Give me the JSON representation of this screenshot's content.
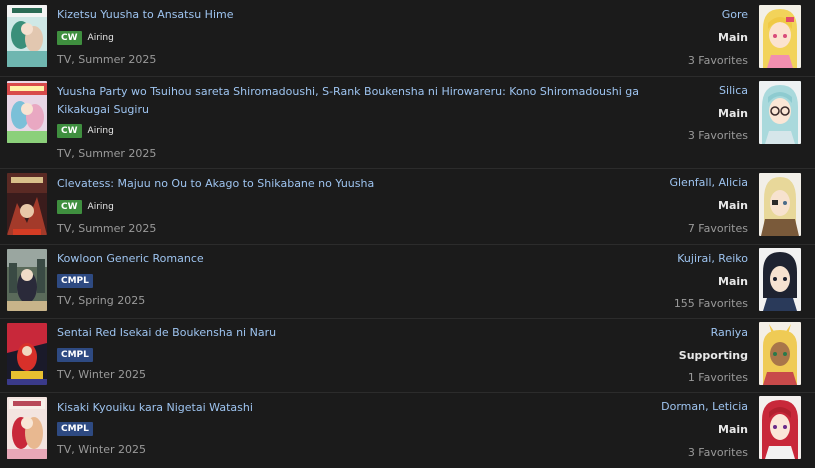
{
  "colors": {
    "background": "#1b1b1b",
    "link": "#9ec4f0",
    "cw_badge": "#3f8f3f",
    "cmpl_badge": "#2e4a82"
  },
  "entries": [
    {
      "title": "Kizetsu Yuusha to Ansatsu Hime",
      "badge": "CW",
      "badge_color": "#3f8f3f",
      "status": "Airing",
      "meta": "TV, Summer 2025",
      "character": "Gore",
      "role": "Main",
      "favorites": "3 Favorites",
      "cover_icon": "anime-cover-image",
      "portrait_icon": "blonde-girl-portrait"
    },
    {
      "title": "Yuusha Party wo Tsuihou sareta Shiromadoushi, S-Rank Boukensha ni Hirowareru: Kono Shiromadoushi ga Kikakugai Sugiru",
      "badge": "CW",
      "badge_color": "#3f8f3f",
      "status": "Airing",
      "meta": "TV, Summer 2025",
      "character": "Silica",
      "role": "Main",
      "favorites": "3 Favorites",
      "cover_icon": "anime-cover-image",
      "portrait_icon": "teal-hair-glasses-girl-portrait"
    },
    {
      "title": "Clevatess: Majuu no Ou to Akago to Shikabane no Yuusha",
      "badge": "CW",
      "badge_color": "#3f8f3f",
      "status": "Airing",
      "meta": "TV, Summer 2025",
      "character": "Glenfall, Alicia",
      "role": "Main",
      "favorites": "7 Favorites",
      "cover_icon": "anime-cover-image",
      "portrait_icon": "blonde-eyepatch-girl-portrait"
    },
    {
      "title": "Kowloon Generic Romance",
      "badge": "CMPL",
      "badge_color": "#2e4a82",
      "status": "",
      "meta": "TV, Spring 2025",
      "character": "Kujirai, Reiko",
      "role": "Main",
      "favorites": "155 Favorites",
      "cover_icon": "anime-cover-image",
      "portrait_icon": "dark-hair-girl-portrait"
    },
    {
      "title": "Sentai Red Isekai de Boukensha ni Naru",
      "badge": "CMPL",
      "badge_color": "#2e4a82",
      "status": "",
      "meta": "TV, Winter 2025",
      "character": "Raniya",
      "role": "Supporting",
      "favorites": "1 Favorites",
      "cover_icon": "anime-cover-image",
      "portrait_icon": "blonde-bunny-girl-portrait"
    },
    {
      "title": "Kisaki Kyouiku kara Nigetai Watashi",
      "badge": "CMPL",
      "badge_color": "#2e4a82",
      "status": "",
      "meta": "TV, Winter 2025",
      "character": "Dorman, Leticia",
      "role": "Main",
      "favorites": "3 Favorites",
      "cover_icon": "anime-cover-image",
      "portrait_icon": "red-hair-girl-portrait"
    }
  ]
}
